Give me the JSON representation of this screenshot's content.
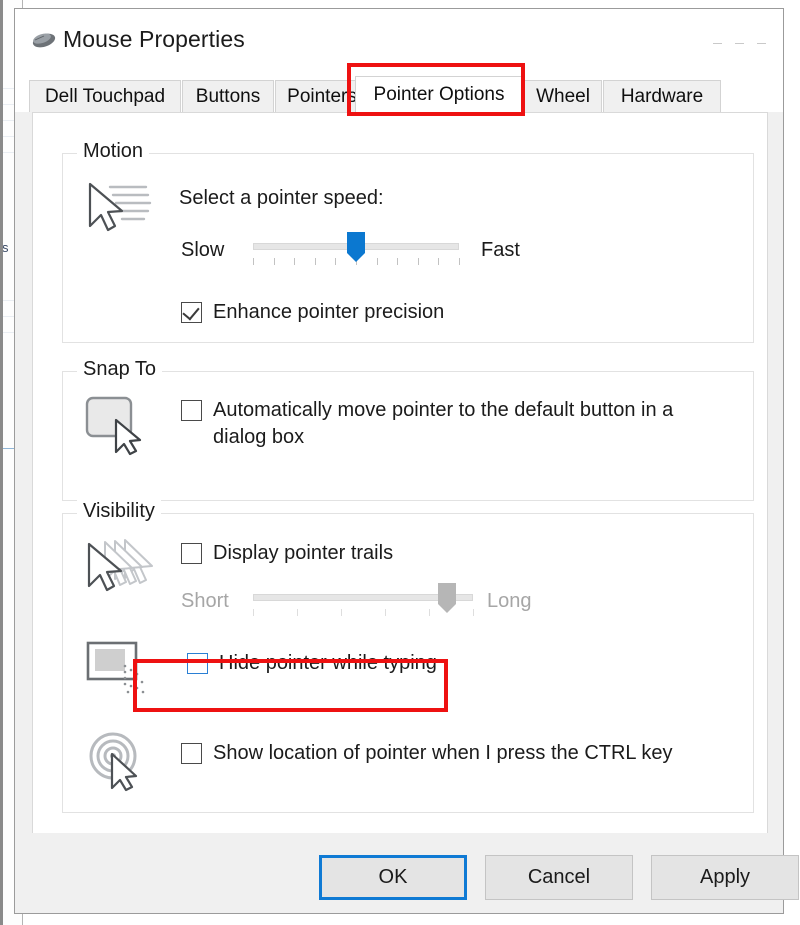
{
  "window": {
    "title": "Mouse Properties",
    "icon": "mouse-icon",
    "controls": [
      "minimize",
      "maximize",
      "close"
    ]
  },
  "tabs": [
    {
      "label": "Dell Touchpad",
      "active": false
    },
    {
      "label": "Buttons",
      "active": false
    },
    {
      "label": "Pointers",
      "active": false
    },
    {
      "label": "Pointer Options",
      "active": true
    },
    {
      "label": "Wheel",
      "active": false
    },
    {
      "label": "Hardware",
      "active": false
    }
  ],
  "groups": {
    "motion": {
      "legend": "Motion",
      "icon": "pointer-speed-icon",
      "speed_label": "Select a pointer speed:",
      "slider": {
        "min_label": "Slow",
        "max_label": "Fast",
        "value_percent": 50,
        "tick_count": 11,
        "enabled": true
      },
      "checkbox": {
        "label": "Enhance pointer precision",
        "checked": true,
        "focused": false
      }
    },
    "snap_to": {
      "legend": "Snap To",
      "icon": "default-button-snap-icon",
      "checkbox": {
        "label": "Automatically move pointer to the default button in a dialog box",
        "checked": false,
        "focused": false
      }
    },
    "visibility": {
      "legend": "Visibility",
      "trails": {
        "icon": "pointer-trails-icon",
        "checkbox": {
          "label": "Display pointer trails",
          "checked": false,
          "focused": false
        },
        "slider": {
          "min_label": "Short",
          "max_label": "Long",
          "value_percent": 88,
          "tick_count": 6,
          "enabled": false
        }
      },
      "hide_typing": {
        "icon": "hide-pointer-typing-icon",
        "checkbox": {
          "label": "Hide pointer while typing",
          "checked": false,
          "focused": true
        },
        "highlighted": true
      },
      "ctrl_locate": {
        "icon": "locate-pointer-ctrl-icon",
        "checkbox": {
          "label": "Show location of pointer when I press the CTRL key",
          "checked": false,
          "focused": false
        }
      }
    }
  },
  "buttons": {
    "ok": "OK",
    "cancel": "Cancel",
    "apply": "Apply"
  },
  "annotations": {
    "accent_color": "#ee1111",
    "focus_color": "#0f7ad4",
    "slider_active_color": "#0b78d0",
    "targets": [
      "tab-pointer-options",
      "checkbox-hide-pointer-while-typing"
    ]
  }
}
